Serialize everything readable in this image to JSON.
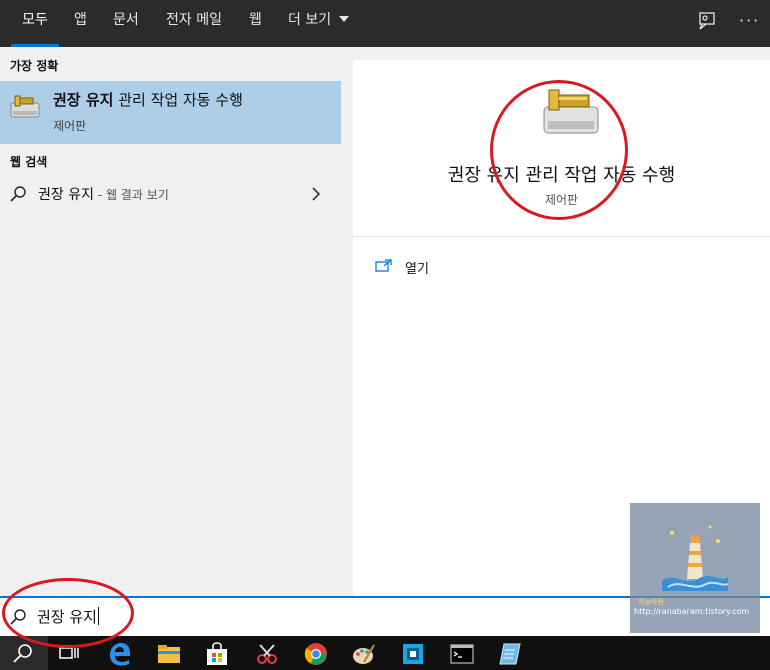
{
  "tabs": [
    {
      "label": "모두"
    },
    {
      "label": "앱"
    },
    {
      "label": "문서"
    },
    {
      "label": "전자 메일"
    },
    {
      "label": "웹"
    },
    {
      "label": "더 보기"
    }
  ],
  "best_match": {
    "section": "가장 정확",
    "title_bold": "권장 유지",
    "title_rest": " 관리 작업 자동 수행",
    "subtitle": "제어판"
  },
  "web": {
    "section": "웹 검색",
    "query": "권장 유지",
    "hint": " - 웹 결과 보기"
  },
  "detail": {
    "title": "권장 유지 관리 작업 자동 수행",
    "subtitle": "제어판",
    "open_label": "열기"
  },
  "search": {
    "value": "권장 유지"
  },
  "watermark": {
    "name": "하늘바람",
    "url": "http://ranabaram.tistory.com"
  },
  "colors": {
    "accent": "#0078d7",
    "selected": "#aecde7",
    "annotation": "#d9181f"
  }
}
